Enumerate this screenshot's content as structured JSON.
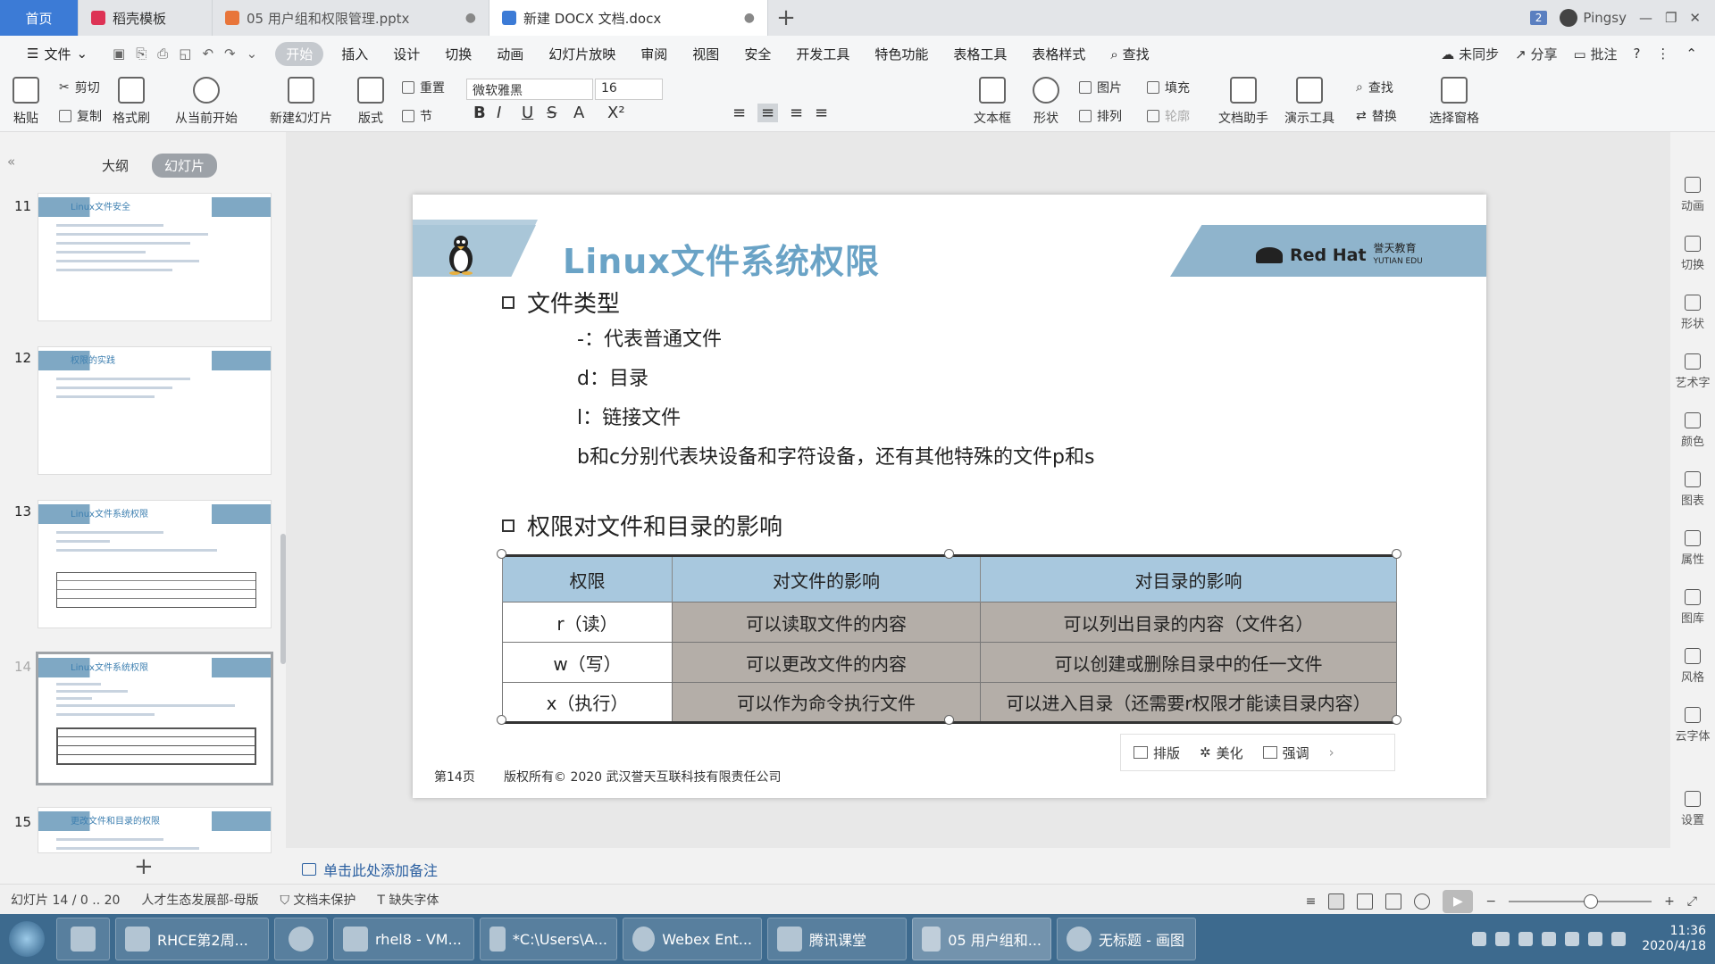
{
  "colors": {
    "accent": "#3c7bd6",
    "title_blue": "#6aa3c6",
    "header_band": "#8fb4cc",
    "table_header": "#a8c8de",
    "table_cell_gray": "#b4aea8",
    "taskbar": "#3d6a8e"
  },
  "tabs": [
    {
      "label": "首页"
    },
    {
      "label": "稻壳模板"
    },
    {
      "label": "05 用户组和权限管理.pptx"
    },
    {
      "label": "新建 DOCX 文档.docx"
    }
  ],
  "titlebar": {
    "badge": "2",
    "user": "Pingsy"
  },
  "menu": {
    "file": "文件",
    "items": [
      "开始",
      "插入",
      "设计",
      "切换",
      "动画",
      "幻灯片放映",
      "审阅",
      "视图",
      "安全",
      "开发工具",
      "特色功能",
      "表格工具",
      "表格样式"
    ],
    "search": "查找",
    "right": [
      "未同步",
      "分享",
      "批注"
    ]
  },
  "ribbon": {
    "paste": "粘贴",
    "cut": "剪切",
    "copy": "复制",
    "format_painter": "格式刷",
    "from_current": "从当前开始",
    "new_slide": "新建幻灯片",
    "layout": "版式",
    "reset": "重置",
    "section": "节",
    "font": "微软雅黑",
    "size": "16",
    "textbox": "文本框",
    "shape": "形状",
    "picture": "图片",
    "fill": "填充",
    "arrange": "排列",
    "outline": "轮廓",
    "doc_helper": "文档助手",
    "presenter": "演示工具",
    "find": "查找",
    "replace": "替换",
    "select_pane": "选择窗格"
  },
  "sidebar": {
    "tab_outline": "大纲",
    "tab_slides": "幻灯片",
    "thumbs": [
      {
        "num": "11",
        "title": "Linux文件安全"
      },
      {
        "num": "12",
        "title": "权限的实践"
      },
      {
        "num": "13",
        "title": "Linux文件系统权限"
      },
      {
        "num": "14",
        "title": "Linux文件系统权限"
      },
      {
        "num": "15",
        "title": "更改文件和目录的权限"
      }
    ]
  },
  "slide": {
    "title": "Linux文件系统权限",
    "brand": "Red Hat",
    "brand2": "誉天教育",
    "brand3": "YUTIAN EDU",
    "sec1": "文件类型",
    "lines": [
      "-：代表普通文件",
      "d：目录",
      "l：链接文件",
      "b和c分别代表块设备和字符设备，还有其他特殊的文件p和s"
    ],
    "sec2": "权限对文件和目录的影响",
    "table": {
      "headers": [
        "权限",
        "对文件的影响",
        "对目录的影响"
      ],
      "rows": [
        [
          "r（读）",
          "可以读取文件的内容",
          "可以列出目录的内容（文件名）"
        ],
        [
          "w（写）",
          "可以更改文件的内容",
          "可以创建或删除目录中的任一文件"
        ],
        [
          "x（执行）",
          "可以作为命令执行文件",
          "可以进入目录（还需要r权限才能读目录内容）"
        ]
      ]
    },
    "page": "第14页",
    "copyright": "版权所有© 2020 武汉誉天互联科技有限责任公司"
  },
  "float_toolbar": {
    "layout": "排版",
    "beautify": "美化",
    "emphasis": "强调"
  },
  "notes": "单击此处添加备注",
  "right_panel": [
    "动画",
    "切换",
    "形状",
    "艺术字",
    "颜色",
    "图表",
    "属性",
    "图库",
    "风格",
    "云字体",
    "设置"
  ],
  "status": {
    "slide_info": "幻灯片 14 / 0 .. 20",
    "theme": "人才生态发展部-母版",
    "protect": "文档未保护",
    "font_missing": "缺失字体"
  },
  "taskbar": {
    "items": [
      "RHCE第2周...",
      "rhel8 - VM...",
      "*C:\\Users\\A...",
      "Webex Ent...",
      "腾讯课堂",
      "05 用户组和...",
      "无标题 - 画图"
    ],
    "time": "11:36",
    "date": "2020/4/18"
  }
}
